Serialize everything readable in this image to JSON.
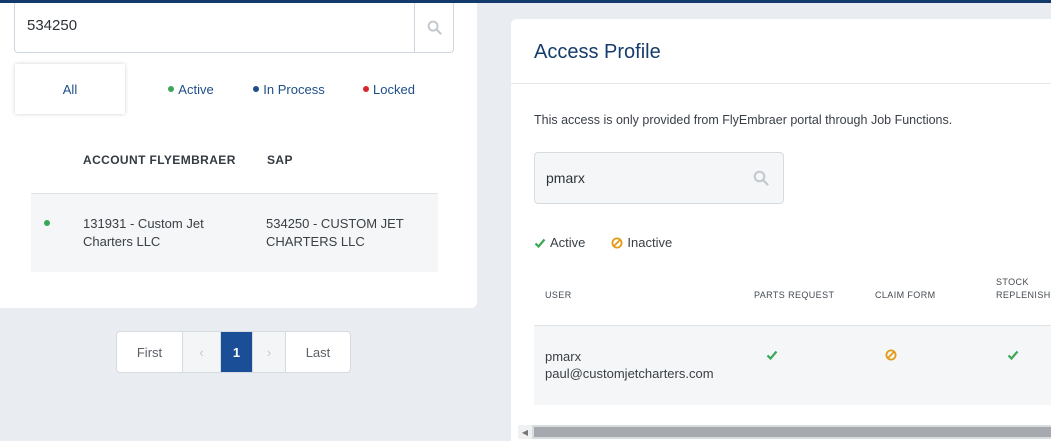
{
  "search": {
    "value": "534250"
  },
  "tabs": [
    {
      "label": "All"
    },
    {
      "label": "Active",
      "dot_color": "#3aa757"
    },
    {
      "label": "In Process",
      "dot_color": "#1d4e89"
    },
    {
      "label": "Locked",
      "dot_color": "#d9262e"
    }
  ],
  "accounts_table": {
    "headers": [
      "ACCOUNT FLYEMBRAER",
      "SAP"
    ],
    "rows": [
      {
        "status": "active",
        "account": "131931 - Custom Jet Charters LLC",
        "sap": "534250 - CUSTOM JET CHARTERS LLC"
      }
    ]
  },
  "pagination": {
    "first": "First",
    "prev": "‹",
    "current": "1",
    "next": "›",
    "last": "Last"
  },
  "access_profile": {
    "title": "Access Profile",
    "note": "This access is only provided from FlyEmbraer portal through Job Functions.",
    "search_value": "pmarx",
    "legend": {
      "active": "Active",
      "inactive": "Inactive"
    },
    "headers": {
      "user": "USER",
      "parts_request": "PARTS REQUEST",
      "claim_form": "CLAIM FORM",
      "stock_line1": "STOCK",
      "stock_line2": "REPLENISH"
    },
    "rows": [
      {
        "username": "pmarx",
        "email": "paul@customjetcharters.com",
        "parts_request": "active",
        "claim_form": "inactive",
        "stock_replenish": "active"
      }
    ]
  },
  "colors": {
    "brand": "#1a4e96",
    "active": "#3aa757",
    "inactive": "#e39a16",
    "locked": "#d9262e"
  }
}
